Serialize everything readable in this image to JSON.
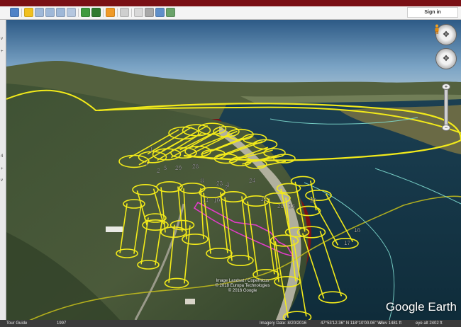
{
  "toolbar": {
    "buttons": [
      "sidebar",
      "placemark",
      "polygon",
      "path",
      "image-overlay",
      "tour",
      "historical-imagery",
      "sun",
      "planets",
      "ruler",
      "email",
      "print",
      "save-image",
      "google-maps"
    ],
    "signin_label": "Sign in"
  },
  "left_panel": {
    "marks": [
      "v",
      "+",
      "4",
      "+",
      "v"
    ]
  },
  "map": {
    "flight_labels": [
      "1",
      "2",
      "29",
      "4",
      "5",
      "28",
      "8",
      "3",
      "23",
      "24",
      "7",
      "12",
      "21",
      "13",
      "20",
      "16",
      "17",
      "14",
      "10"
    ],
    "attribution": [
      "Image Landsat / Copernicus",
      "© 2018 Europa Technologies",
      "© 2016 Google"
    ],
    "logo": "Google Earth"
  },
  "status": {
    "tour_guide": "Tour Guide",
    "year": "1997",
    "imagery_date": "Imagery Date: 8/20/2016",
    "coordinates": "47°53'12.36\" N 118°10'00.06\" W",
    "elevation": "elev 1481 ft",
    "eye_alt": "eye alt 2402 ft"
  },
  "colors": {
    "flight_lines": "#f2ea1a",
    "boundary": "#e23cc8",
    "shoreline": "#7fdcd0"
  }
}
